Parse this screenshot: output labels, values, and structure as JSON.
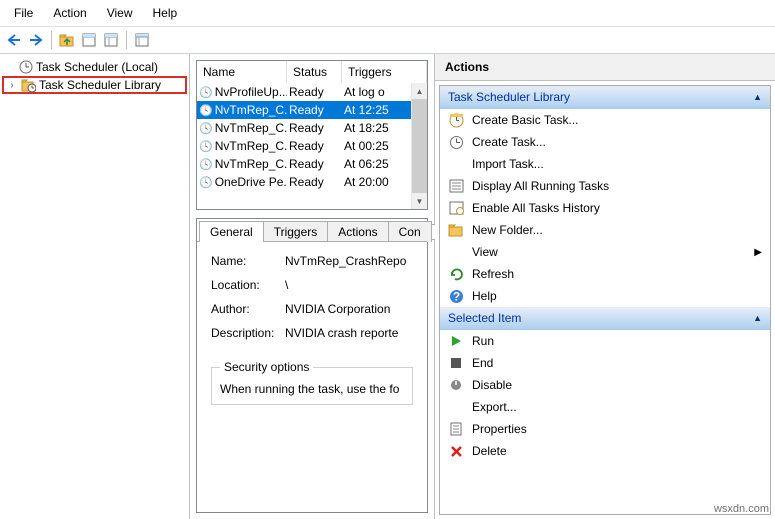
{
  "menu": {
    "file": "File",
    "action": "Action",
    "view": "View",
    "help": "Help"
  },
  "tree": {
    "root": "Task Scheduler (Local)",
    "library": "Task Scheduler Library"
  },
  "cols": {
    "name": "Name",
    "status": "Status",
    "trigger": "Triggers"
  },
  "tasks": [
    {
      "name": "NvProfileUp...",
      "status": "Ready",
      "trigger": "At log o"
    },
    {
      "name": "NvTmRep_C...",
      "status": "Ready",
      "trigger": "At 12:25"
    },
    {
      "name": "NvTmRep_C...",
      "status": "Ready",
      "trigger": "At 18:25"
    },
    {
      "name": "NvTmRep_C...",
      "status": "Ready",
      "trigger": "At 00:25"
    },
    {
      "name": "NvTmRep_C...",
      "status": "Ready",
      "trigger": "At 06:25"
    },
    {
      "name": "OneDrive Pe...",
      "status": "Ready",
      "trigger": "At 20:00"
    }
  ],
  "tabs": {
    "general": "General",
    "triggers": "Triggers",
    "actions": "Actions",
    "con": "Con"
  },
  "general": {
    "name_label": "Name:",
    "name_value": "NvTmRep_CrashRepo",
    "location_label": "Location:",
    "location_value": "\\",
    "author_label": "Author:",
    "author_value": "NVIDIA Corporation",
    "desc_label": "Description:",
    "desc_value": "NVIDIA crash reporte",
    "sec_legend": "Security options",
    "sec_text": "When running the task, use the fo"
  },
  "actions": {
    "header": "Actions",
    "section1": "Task Scheduler Library",
    "create_basic": "Create Basic Task...",
    "create": "Create Task...",
    "import": "Import Task...",
    "display": "Display All Running Tasks",
    "enable_hist": "Enable All Tasks History",
    "new_folder": "New Folder...",
    "view": "View",
    "refresh": "Refresh",
    "help": "Help",
    "section2": "Selected Item",
    "run": "Run",
    "end": "End",
    "disable": "Disable",
    "export": "Export...",
    "properties": "Properties",
    "delete": "Delete"
  },
  "watermark": "wsxdn.com"
}
